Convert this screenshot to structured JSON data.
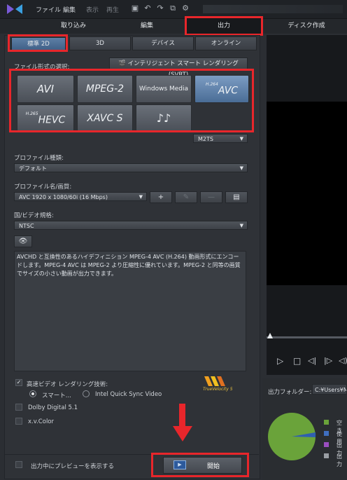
{
  "menu": {
    "file": "ファイル",
    "edit": "編集",
    "view": "表示",
    "play": "再生"
  },
  "tabs": {
    "import": "取り込み",
    "edit": "編集",
    "output": "出力",
    "disc": "ディスク作成"
  },
  "subtabs": {
    "std2d": "標準 2D",
    "three_d": "3D",
    "device": "デバイス",
    "online": "オンライン"
  },
  "format_label": "ファイル形式の選択:",
  "svrt_label": "インテリジェント スマート レンダリング (SVRT)",
  "formats": [
    {
      "name": "AVI",
      "sup": ""
    },
    {
      "name": "MPEG-2",
      "sup": ""
    },
    {
      "name": "Windows Media",
      "sup": ""
    },
    {
      "name": "AVC",
      "sup": "H.264"
    },
    {
      "name": "HEVC",
      "sup": "H.265"
    },
    {
      "name": "XAVC S",
      "sup": ""
    },
    {
      "name": "♪♪",
      "sup": ""
    }
  ],
  "container": "M2TS",
  "profile_type_label": "プロファイル種類:",
  "profile_type_value": "デフォルト",
  "profile_name_label": "プロファイル名/画質:",
  "profile_name_value": "AVC 1920 x 1080/60i (16 Mbps)",
  "country_label": "国/ビデオ規格:",
  "country_value": "NTSC",
  "description": "AVCHD と互換性のあるハイデフィニション MPEG-4 AVC (H.264) 動画形式にエンコードします。MPEG-4 AVC は MPEG-2 より圧縮性に優れています。MPEG-2 と同等の画質でサイズの小さい動画が出力できます。",
  "fast_render_label": "高速ビデオ レンダリング技術:",
  "smart_label": "スマート...",
  "intel_label": "Intel Quick Sync Video",
  "velocity_label": "TrueVelocity 5",
  "dolby_label": "Dolby Digital 5.1",
  "xv_label": "x.v.Color",
  "preview_label": "出力中にプレビューを表示する",
  "start_label": "開始",
  "output_folder_label": "出力フォルダー:",
  "output_folder_value": "C:¥Users¥MY",
  "legend": [
    "空き",
    "使用",
    "出力",
    "出力"
  ],
  "colors": {
    "accent": "#e8262b",
    "selected_blue": "#5b7fa8",
    "pie_green": "#6aa33a",
    "pie_blue": "#2f5fb0"
  }
}
